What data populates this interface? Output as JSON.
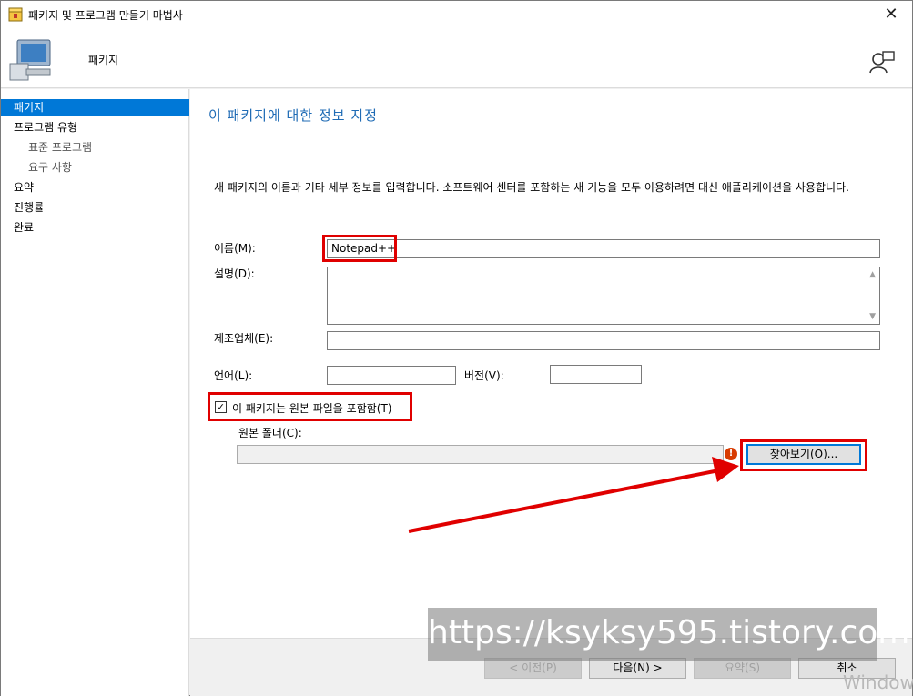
{
  "window": {
    "title": "패키지 및 프로그램 만들기 마법사",
    "close": "✕"
  },
  "header": {
    "title": "패키지"
  },
  "sidebar": {
    "items": [
      {
        "label": "패키지",
        "active": true,
        "sub": false
      },
      {
        "label": "프로그램 유형",
        "active": false,
        "sub": false
      },
      {
        "label": "표준 프로그램",
        "active": false,
        "sub": true
      },
      {
        "label": "요구 사항",
        "active": false,
        "sub": true
      },
      {
        "label": "요약",
        "active": false,
        "sub": false
      },
      {
        "label": "진행률",
        "active": false,
        "sub": false
      },
      {
        "label": "완료",
        "active": false,
        "sub": false
      }
    ]
  },
  "main": {
    "title": "이 패키지에 대한 정보 지정",
    "description": "새 패키지의 이름과 기타 세부 정보를 입력합니다. 소프트웨어 센터를 포함하는 새 기능을 모두 이용하려면 대신 애플리케이션을 사용합니다.",
    "name_label": "이름(M):",
    "name_value": "Notepad++",
    "desc_label": "설명(D):",
    "manufacturer_label": "제조업체(E):",
    "language_label": "언어(L):",
    "version_label": "버전(V):",
    "source_checkbox_label": "이 패키지는 원본 파일을 포함함(T)",
    "source_checked": true,
    "source_folder_label": "원본 폴더(C):",
    "browse_label": "찾아보기(O)..."
  },
  "footer": {
    "prev": "< 이전(P)",
    "next": "다음(N) >",
    "summary": "요약(S)",
    "cancel": "취소"
  },
  "overlay": {
    "watermark": "https://ksyksy595.tistory.com",
    "windows_text": "Window"
  },
  "colors": {
    "accent": "#0078d7",
    "annotation": "#e00000",
    "title_blue": "#1f6bb5"
  }
}
